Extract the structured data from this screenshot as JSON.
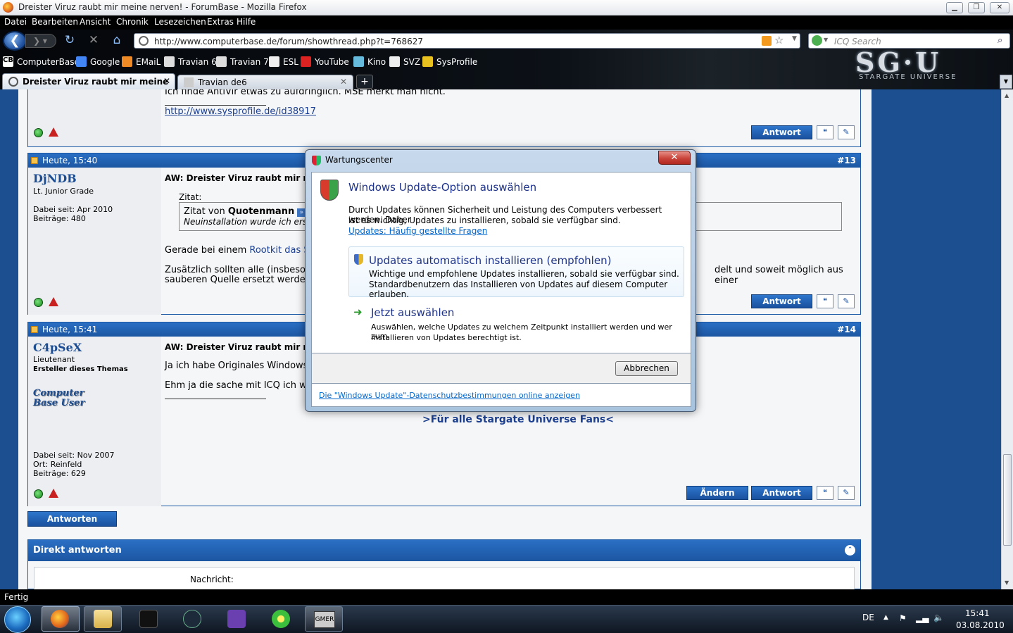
{
  "window": {
    "title": "Dreister Viruz raubt mir meine nerven! - ForumBase - Mozilla Firefox"
  },
  "menu": [
    "Datei",
    "Bearbeiten",
    "Ansicht",
    "Chronik",
    "Lesezeichen",
    "Extras",
    "Hilfe"
  ],
  "nav": {
    "url": "http://www.computerbase.de/forum/showthread.php?t=768627",
    "search_placeholder": "ICQ Search"
  },
  "bookmarks": [
    "ComputerBase",
    "Google",
    "EMaiL",
    "Travian 6",
    "Travian 7",
    "ESL",
    "YouTube",
    "Kino",
    "SVZ",
    "SysProfile"
  ],
  "branding": {
    "logo": "SG·U",
    "subtitle": "STARGATE UNIVERSE"
  },
  "tabs": [
    {
      "label": "Dreister Viruz raubt mir meine n..."
    },
    {
      "label": "Travian de6"
    }
  ],
  "posts": {
    "p12": {
      "text": "Ich finde AntiVir etwas zu aufdringlich. MSE merkt man nicht.",
      "link": "http://www.sysprofile.de/id38917",
      "reply": "Antwort"
    },
    "p13": {
      "date": "Heute, 15:40",
      "num": "#13",
      "user": "DjNDB",
      "rank": "Lt. Junior Grade",
      "since": "Dabei seit: Apr 2010",
      "posts": "Beiträge: 480",
      "title": "AW: Dreister Viruz raubt mir m",
      "quote_label": "Zitat:",
      "quote_from": "Zitat von ",
      "quote_user": "Quotenmann",
      "quote_text": "Neuinstallation wurde ich ers",
      "line1a": "Gerade bei einem ",
      "line1b": "Rootkit das S",
      "line2": "Zusätzlich sollten alle (insbeson",
      "line2r": "delt und soweit möglich aus einer",
      "line3": "sauberen Quelle ersetzt werder",
      "reply": "Antwort"
    },
    "p14": {
      "date": "Heute, 15:41",
      "num": "#14",
      "user": "C4pSeX",
      "rank": "Lieutenant",
      "starter": "Ersteller dieses Themas",
      "avatar": "Computer Base User",
      "since": "Dabei seit: Nov 2007",
      "loc": "Ort: Reinfeld",
      "posts": "Beiträge: 629",
      "title": "AW: Dreister Viruz raubt mir m",
      "line1": "Ja ich habe Originales Windows",
      "line2": "Ehm ja die sache mit ICQ ich wo",
      "sig": ">Für alle Stargate Universe Fans<",
      "edit": "Ändern",
      "reply": "Antwort"
    }
  },
  "reply_button": "Antworten",
  "quick_reply": {
    "title": "Direkt antworten",
    "message_label": "Nachricht:"
  },
  "dialog": {
    "caption": "Wartungscenter",
    "heading": "Windows Update-Option auswählen",
    "desc1": "Durch Updates können Sicherheit und Leistung des Computers verbessert werden. Daher",
    "desc2": "ist es wichtig, Updates zu installieren, sobald sie verfügbar sind.",
    "faq": "Updates: Häufig gestellte Fragen",
    "opt1_title": "Updates automatisch installieren (empfohlen)",
    "opt1_l1": "Wichtige und empfohlene Updates installieren, sobald sie verfügbar sind.",
    "opt1_l2": "Standardbenutzern das Installieren von Updates auf diesem Computer erlauben.",
    "opt2_title": "Jetzt auswählen",
    "opt2_l1": "Auswählen, welche Updates zu welchem Zeitpunkt installiert werden und wer zum",
    "opt2_l2": "Installieren von Updates berechtigt ist.",
    "cancel": "Abbrechen",
    "privacy": "Die \"Windows Update\"-Datenschutzbestimmungen online anzeigen"
  },
  "status": "Fertig",
  "tray": {
    "lang": "DE",
    "time": "15:41",
    "date": "03.08.2010"
  },
  "taskbar_items": [
    "GMER"
  ]
}
